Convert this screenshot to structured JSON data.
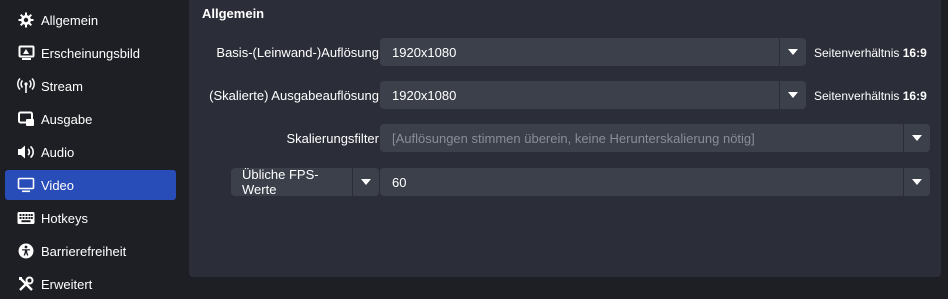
{
  "sidebar": {
    "items": [
      {
        "label": "Allgemein",
        "icon": "gear-icon"
      },
      {
        "label": "Erscheinungsbild",
        "icon": "appearance-icon"
      },
      {
        "label": "Stream",
        "icon": "antenna-icon"
      },
      {
        "label": "Ausgabe",
        "icon": "output-icon"
      },
      {
        "label": "Audio",
        "icon": "speaker-icon"
      },
      {
        "label": "Video",
        "icon": "monitor-icon",
        "active": true
      },
      {
        "label": "Hotkeys",
        "icon": "keyboard-icon"
      },
      {
        "label": "Barrierefreiheit",
        "icon": "accessibility-icon"
      },
      {
        "label": "Erweitert",
        "icon": "tools-icon"
      }
    ]
  },
  "group": {
    "title": "Allgemein",
    "base_resolution": {
      "label": "Basis-(Leinwand-)Auflösung",
      "value": "1920x1080",
      "aspect_prefix": "Seitenverhältnis",
      "aspect_value": "16:9"
    },
    "output_resolution": {
      "label": "(Skalierte) Ausgabeauflösung",
      "value": "1920x1080",
      "aspect_prefix": "Seitenverhältnis",
      "aspect_value": "16:9"
    },
    "scale_filter": {
      "label": "Skalierungsfilter",
      "value": "[Auflösungen stimmen überein, keine Herunterskalierung nötig]"
    },
    "fps": {
      "type_label": "Übliche FPS-Werte",
      "value": "60"
    }
  },
  "colors": {
    "background": "#1e1f24",
    "group_bg": "#2b2e38",
    "input_bg": "#3c404b",
    "active_nav": "#284cb8"
  }
}
